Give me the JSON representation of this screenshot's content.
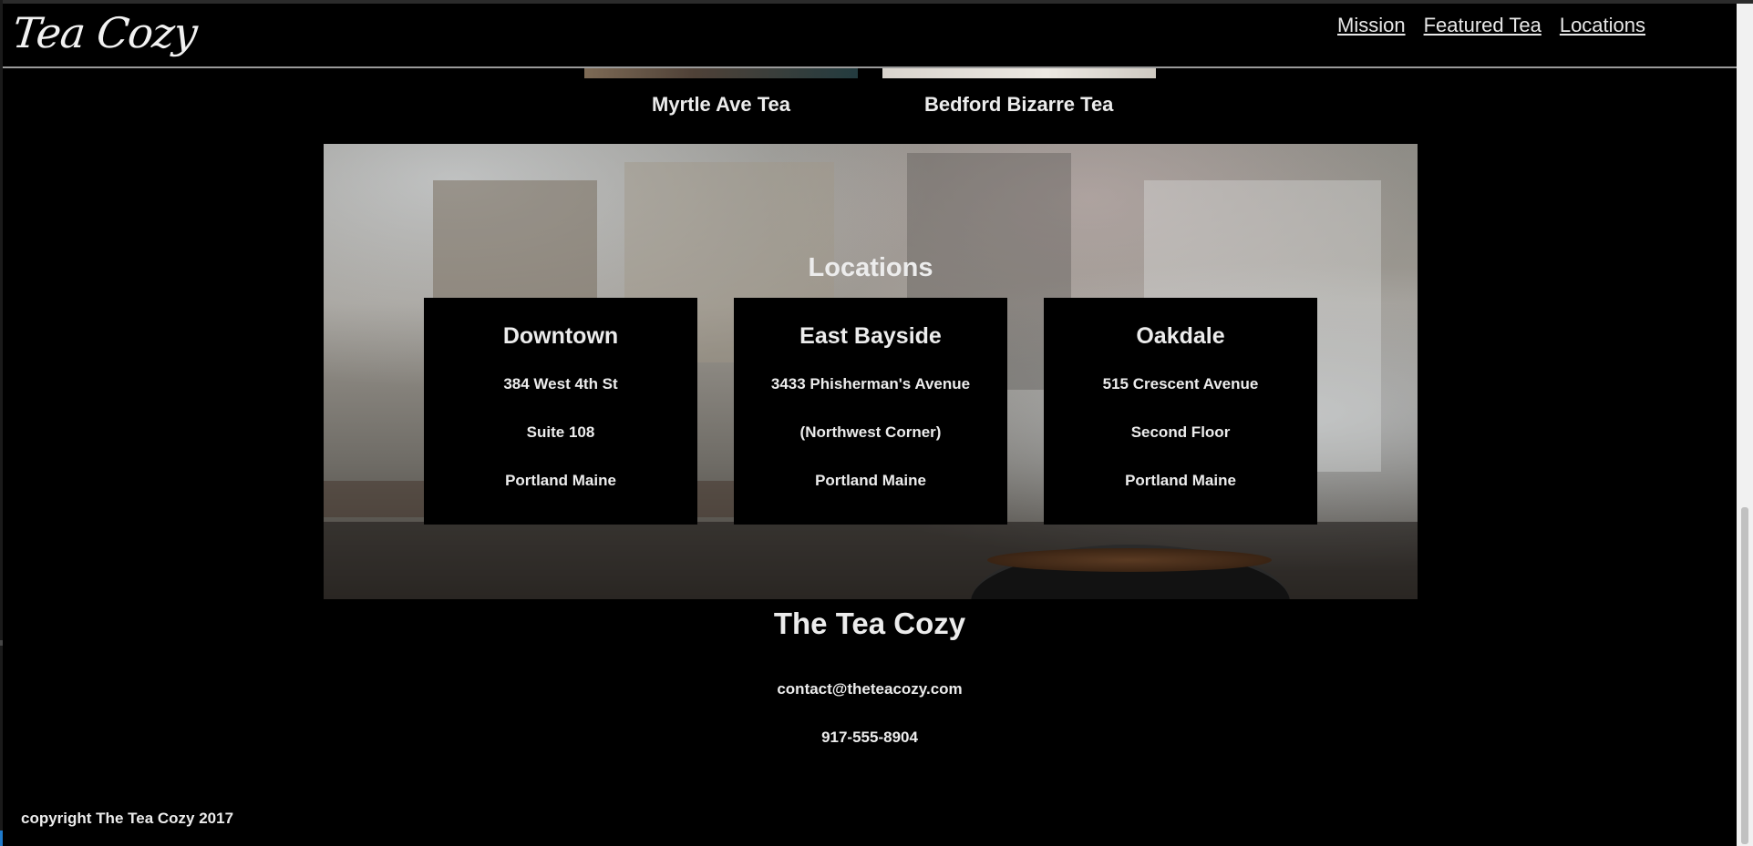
{
  "header": {
    "logo": "Tea Cozy",
    "nav": [
      "Mission",
      "Featured Tea",
      "Locations"
    ]
  },
  "featured": {
    "items": [
      "Myrtle Ave Tea",
      "Bedford Bizarre Tea"
    ]
  },
  "locations": {
    "heading": "Locations",
    "cards": [
      {
        "name": "Downtown",
        "line1": "384 West 4th St",
        "line2": "Suite 108",
        "line3": "Portland Maine"
      },
      {
        "name": "East Bayside",
        "line1": "3433 Phisherman's Avenue",
        "line2": "(Northwest Corner)",
        "line3": "Portland Maine"
      },
      {
        "name": "Oakdale",
        "line1": "515 Crescent Avenue",
        "line2": "Second Floor",
        "line3": "Portland Maine"
      }
    ]
  },
  "footer": {
    "title": "The Tea Cozy",
    "email": "contact@theteacozy.com",
    "phone": "917-555-8904",
    "copyright": "copyright The Tea Cozy 2017"
  }
}
